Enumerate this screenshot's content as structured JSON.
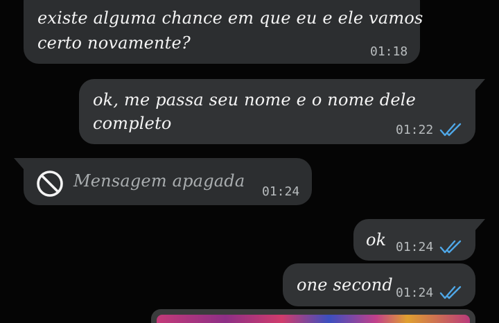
{
  "messages": [
    {
      "id": "m1",
      "direction": "incoming",
      "text_line1": "existe alguma chance em que eu e ele vamos",
      "text_line2": "certo novamente?",
      "time": "01:18"
    },
    {
      "id": "m2",
      "direction": "outgoing",
      "text_line1": "ok, me passa seu nome e o nome dele",
      "text_line2": "completo",
      "time": "01:22",
      "status": "read"
    },
    {
      "id": "m3",
      "direction": "incoming",
      "deleted": true,
      "text": "Mensagem apagada",
      "time": "01:24",
      "icon": "blocked-icon"
    },
    {
      "id": "m4",
      "direction": "outgoing",
      "text": "ok",
      "time": "01:24",
      "status": "read"
    },
    {
      "id": "m5",
      "direction": "outgoing",
      "text": "one second",
      "time": "01:24",
      "status": "read"
    }
  ],
  "colors": {
    "background": "#050505",
    "bubble": "#313335",
    "read_ticks": "#4fa8e8",
    "time": "#b8bcbe"
  }
}
